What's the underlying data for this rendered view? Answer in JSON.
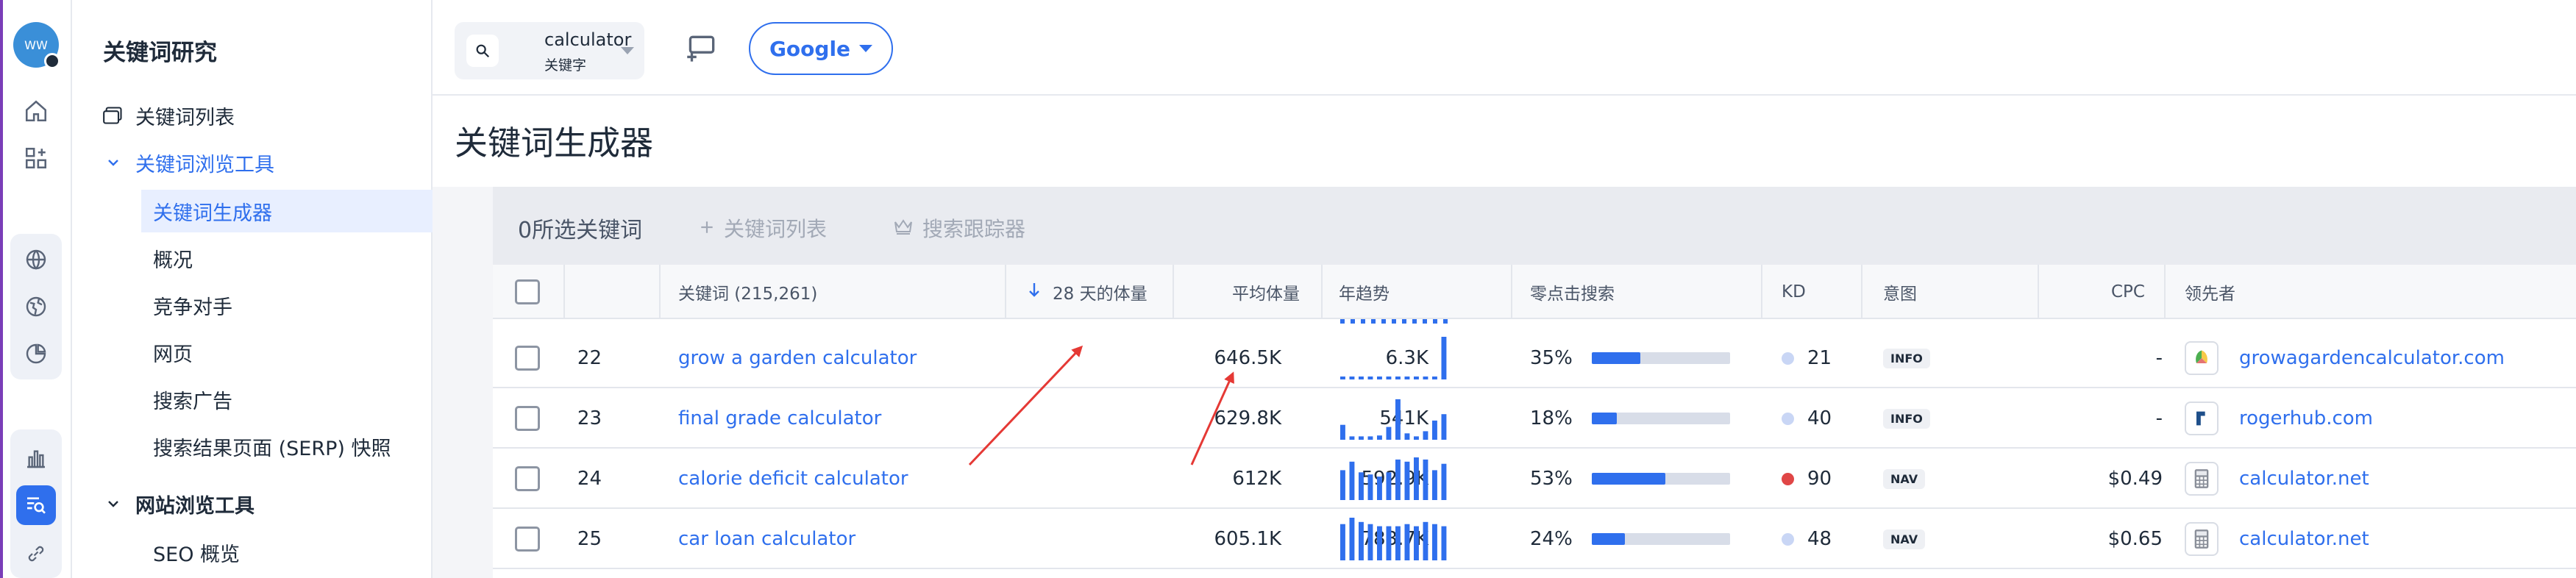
{
  "sidebar": {
    "title": "关键词研究",
    "items": [
      {
        "label": "关键词列表"
      },
      {
        "label": "关键词浏览工具"
      },
      {
        "label": "关键词生成器"
      },
      {
        "label": "概况"
      },
      {
        "label": "竞争对手"
      },
      {
        "label": "网页"
      },
      {
        "label": "搜索广告"
      },
      {
        "label": "搜索结果页面 (SERP) 快照"
      },
      {
        "label": "网站浏览工具"
      },
      {
        "label": "SEO 概览"
      }
    ]
  },
  "avatar": {
    "initials": "WW"
  },
  "topbar": {
    "query": "calculator",
    "query_type": "关键字",
    "engine": "Google"
  },
  "page": {
    "title": "关键词生成器"
  },
  "actions": {
    "selected": "0所选关键词",
    "keyword_list": "关键词列表",
    "tracker": "搜索跟踪器"
  },
  "table": {
    "headers": {
      "keyword": "关键词 (215,261)",
      "volume28": "28 天的体量",
      "avg_volume": "平均体量",
      "trend": "年趋势",
      "zero_click": "零点击搜索",
      "kd": "KD",
      "intent": "意图",
      "cpc": "CPC",
      "leader": "领先者"
    },
    "rows": [
      {
        "rank": "22",
        "keyword": "grow a garden calculator",
        "volume28": "646.5K",
        "avg": "6.3K",
        "trend": [
          0,
          0,
          0,
          0,
          0,
          0,
          0,
          0,
          0,
          0,
          0,
          1.0
        ],
        "zero": "35%",
        "zero_pct": 35,
        "kd": "21",
        "kd_color": "#c9d6f5",
        "intent": "INFO",
        "cpc": "-",
        "leader": "growagardencalculator.com"
      },
      {
        "rank": "23",
        "keyword": "final grade calculator",
        "volume28": "629.8K",
        "avg": "541K",
        "trend": [
          0.35,
          0.08,
          0.08,
          0.08,
          0.1,
          0.3,
          0.95,
          0.15,
          0.08,
          0.2,
          0.45,
          0.6
        ],
        "zero": "18%",
        "zero_pct": 18,
        "kd": "40",
        "kd_color": "#c9d6f5",
        "intent": "INFO",
        "cpc": "-",
        "leader": "rogerhub.com"
      },
      {
        "rank": "24",
        "keyword": "calorie deficit calculator",
        "volume28": "612K",
        "avg": "592.9K",
        "trend": [
          0.7,
          0.9,
          0.65,
          0.6,
          0.55,
          0.65,
          0.95,
          0.9,
          1.0,
          0.95,
          0.7,
          0.85
        ],
        "zero": "53%",
        "zero_pct": 53,
        "kd": "90",
        "kd_color": "#e04646",
        "intent": "NAV",
        "cpc": "$0.49",
        "leader": "calculator.net"
      },
      {
        "rank": "25",
        "keyword": "car loan calculator",
        "volume28": "605.1K",
        "avg": "783.7K",
        "trend": [
          0.85,
          1.0,
          0.9,
          0.85,
          0.8,
          0.8,
          0.8,
          0.85,
          0.8,
          0.9,
          0.85,
          0.8
        ],
        "zero": "24%",
        "zero_pct": 24,
        "kd": "48",
        "kd_color": "#c9d6f5",
        "intent": "NAV",
        "cpc": "$0.65",
        "leader": "calculator.net"
      }
    ]
  },
  "colors": {
    "accent": "#2f6fed",
    "annotation": "#e53935"
  }
}
